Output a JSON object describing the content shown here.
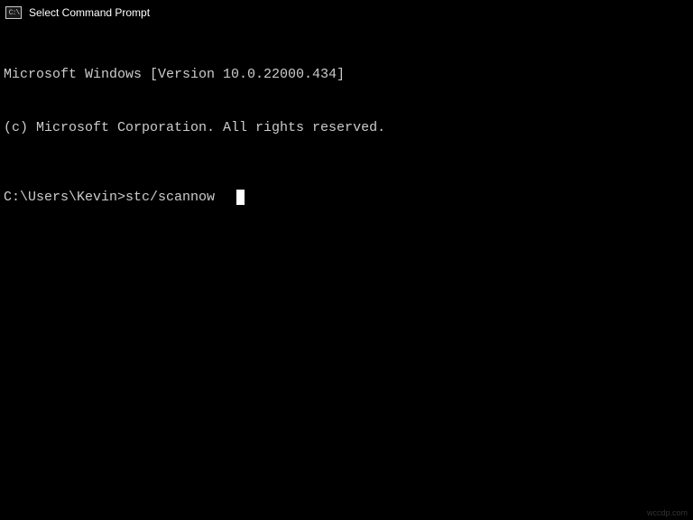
{
  "window": {
    "title": "Select Command Prompt"
  },
  "terminal": {
    "line1": "Microsoft Windows [Version 10.0.22000.434]",
    "line2": "(c) Microsoft Corporation. All rights reserved.",
    "prompt": "C:\\Users\\Kevin>",
    "command": "stc/scannow"
  },
  "watermark": "wccdp.com"
}
